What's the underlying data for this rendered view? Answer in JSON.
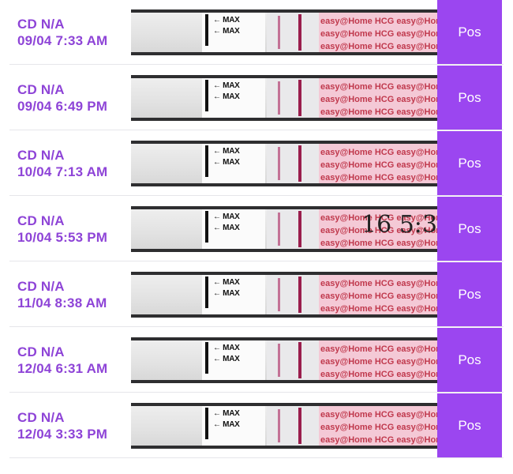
{
  "entries": [
    {
      "cd": "CD N/A",
      "datetime": "09/04 7:33 AM",
      "result": "Pos"
    },
    {
      "cd": "CD N/A",
      "datetime": "09/04 6:49 PM",
      "result": "Pos"
    },
    {
      "cd": "CD N/A",
      "datetime": "10/04 7:13 AM",
      "result": "Pos"
    },
    {
      "cd": "CD N/A",
      "datetime": "10/04 5:53 PM",
      "result": "Pos"
    },
    {
      "cd": "CD N/A",
      "datetime": "11/04 8:38 AM",
      "result": "Pos"
    },
    {
      "cd": "CD N/A",
      "datetime": "12/04 6:31 AM",
      "result": "Pos"
    },
    {
      "cd": "CD N/A",
      "datetime": "12/04 3:33 PM",
      "result": "Pos"
    }
  ],
  "strip_text": {
    "max_marker": "← MAX",
    "brand_line": "easy@Home HCG easy@Home HCG",
    "annotation": "16 5:3"
  },
  "colors": {
    "accent_purple": "#9b46f0",
    "text_purple": "#8e44d7",
    "control_line": "#9a1e4d",
    "test_line": "#b64a7a",
    "strip_pink": "#f4c9d6"
  }
}
